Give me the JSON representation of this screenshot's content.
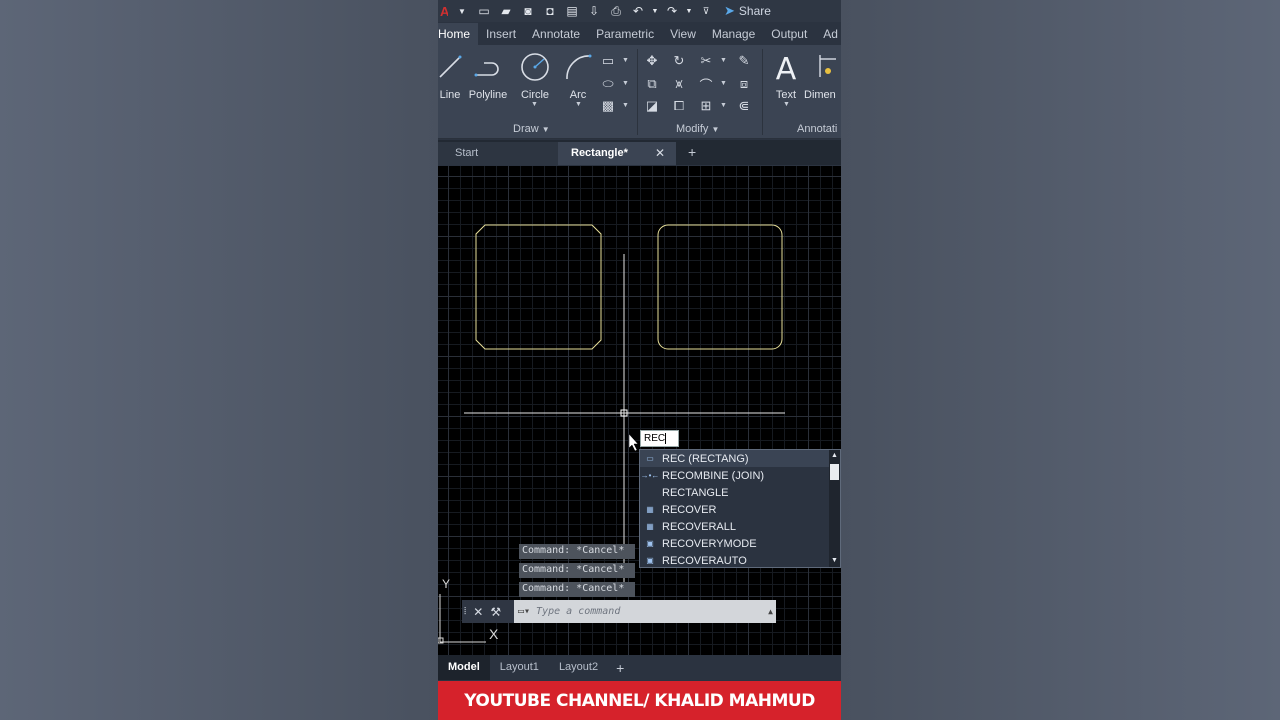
{
  "quick_access": {
    "share_label": "Share"
  },
  "ribbon_tabs": [
    "Home",
    "Insert",
    "Annotate",
    "Parametric",
    "View",
    "Manage",
    "Output",
    "Ad"
  ],
  "ribbon": {
    "draw_tools": [
      "Line",
      "Polyline",
      "Circle",
      "Arc"
    ],
    "draw_panel": "Draw",
    "modify_panel": "Modify",
    "text_tool": "Text",
    "dimension_tool": "Dimen",
    "annotation_panel": "Annotati"
  },
  "document_tabs": {
    "start": "Start",
    "active": "Rectangle*"
  },
  "dynamic_input": {
    "value": "REC"
  },
  "autocomplete": [
    {
      "label": "REC (RECTANG)",
      "icon": "rectangle-icon"
    },
    {
      "label": "RECOMBINE (JOIN)",
      "icon": "join-icon"
    },
    {
      "label": "RECTANGLE",
      "icon": ""
    },
    {
      "label": "RECOVER",
      "icon": "recover-icon"
    },
    {
      "label": "RECOVERALL",
      "icon": "recover-all-icon"
    },
    {
      "label": "RECOVERYMODE",
      "icon": "recovery-mode-icon"
    },
    {
      "label": "RECOVERAUTO",
      "icon": "recover-auto-icon"
    }
  ],
  "command_history": [
    "Command: *Cancel*",
    "Command: *Cancel*",
    "Command: *Cancel*"
  ],
  "command_line": {
    "placeholder": "Type a command"
  },
  "ucs": {
    "y_label": "Y",
    "x_label": "X"
  },
  "layout_tabs": [
    "Model",
    "Layout1",
    "Layout2"
  ],
  "banner": {
    "text": "YOUTUBE CHANNEL/ KHALID MAHMUD"
  },
  "colors": {
    "canvas": "#000000",
    "shape_stroke": "#e8e09a",
    "banner": "#d6222b"
  }
}
